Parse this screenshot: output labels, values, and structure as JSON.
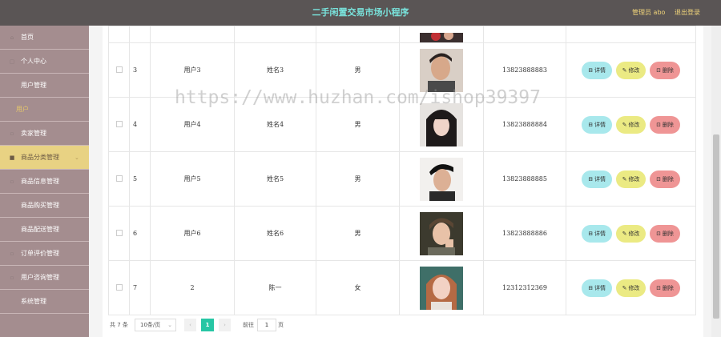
{
  "header": {
    "title": "二手闲置交易市场小程序",
    "admin_label": "管理员 abo",
    "logout_label": "退出登录"
  },
  "sidebar": {
    "items": [
      {
        "label": "首页",
        "icon": "home-icon"
      },
      {
        "label": "个人中心",
        "icon": "user-icon"
      },
      {
        "label": "用户管理",
        "icon": ""
      },
      {
        "label": "用户",
        "icon": ""
      },
      {
        "label": "卖家管理",
        "icon": "seller-icon"
      },
      {
        "label": "商品分类管理",
        "icon": "category-icon"
      },
      {
        "label": "商品信息管理",
        "icon": "goods-icon"
      },
      {
        "label": "商品购买管理",
        "icon": ""
      },
      {
        "label": "商品配送管理",
        "icon": ""
      },
      {
        "label": "订单评价管理",
        "icon": "comment-icon"
      },
      {
        "label": "用户咨询管理",
        "icon": "consult-icon"
      },
      {
        "label": "系统管理",
        "icon": ""
      }
    ]
  },
  "table": {
    "rows": [
      {
        "index": "3",
        "account": "用户3",
        "name": "姓名3",
        "gender": "男",
        "phone": "13823888883"
      },
      {
        "index": "4",
        "account": "用户4",
        "name": "姓名4",
        "gender": "男",
        "phone": "13823888884"
      },
      {
        "index": "5",
        "account": "用户5",
        "name": "姓名5",
        "gender": "男",
        "phone": "13823888885"
      },
      {
        "index": "6",
        "account": "用户6",
        "name": "姓名6",
        "gender": "男",
        "phone": "13823888886"
      },
      {
        "index": "7",
        "account": "2",
        "name": "陈一",
        "gender": "女",
        "phone": "12312312369"
      }
    ],
    "actions": {
      "detail": "详情",
      "edit": "修改",
      "delete": "删除"
    }
  },
  "pagination": {
    "total": "共 7 条",
    "page_size": "10条/页",
    "current_page": "1",
    "goto_label": "前往",
    "goto_value": "1",
    "page_unit": "页"
  },
  "watermark": "https://www.huzhan.com/ishop39397",
  "colors": {
    "topbar": "#5a5555",
    "title": "#79e3dc",
    "sidebar": "#a48d8f",
    "active_menu": "#e8d283",
    "detail_button": "#a8e8ec",
    "edit_button": "#ebea83",
    "delete_button": "#ef9595",
    "page_active": "#26c6a4"
  }
}
